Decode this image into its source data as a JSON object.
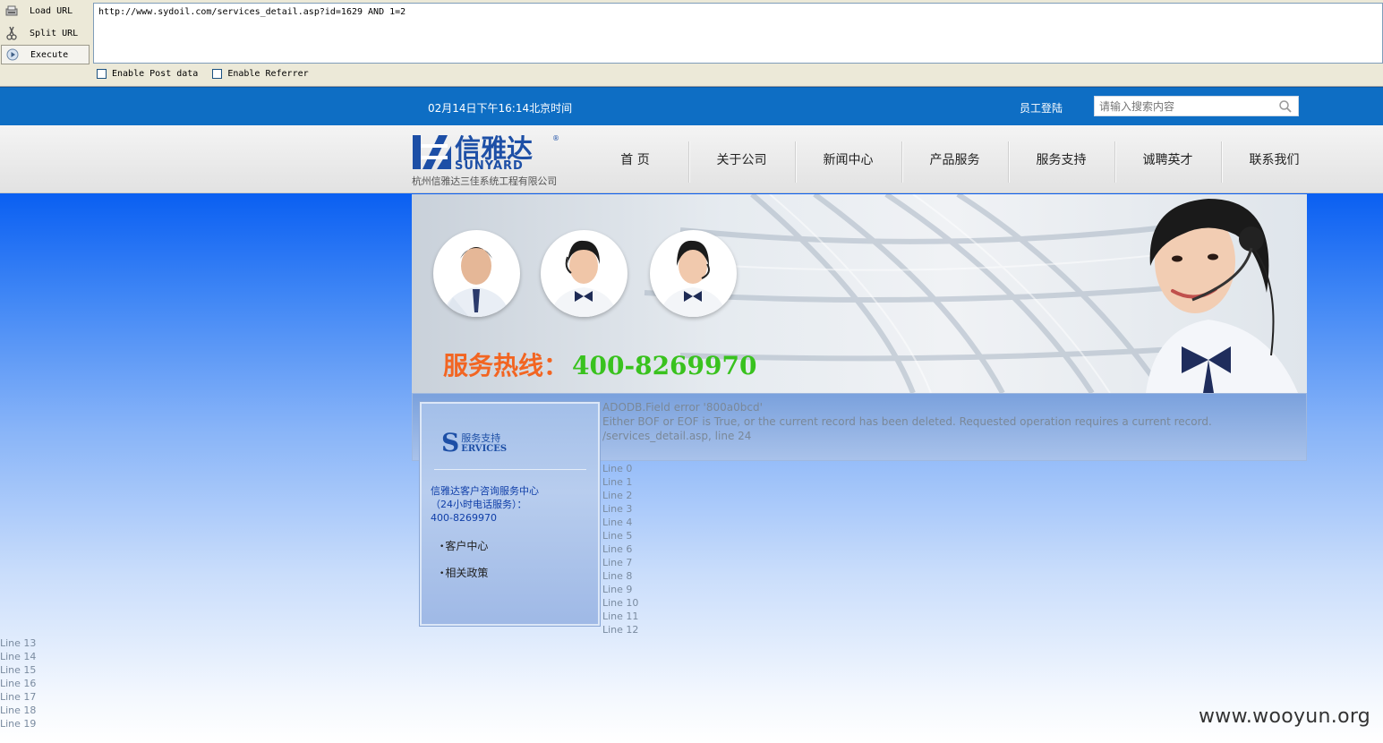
{
  "hackbar": {
    "buttons": [
      "Load URL",
      "Split URL",
      "Execute"
    ],
    "url": "http://www.sydoil.com/services_detail.asp?id=1629 AND 1=2",
    "options": [
      "Enable Post data",
      "Enable Referrer"
    ]
  },
  "topbar": {
    "datetime": "02月14日下午16:14北京时间",
    "login": "员工登陆",
    "search_placeholder": "请输入搜索内容"
  },
  "logo": {
    "brand_cn": "信雅达",
    "brand_en": "SUNYARD",
    "company": "杭州信雅达三佳系统工程有限公司"
  },
  "nav": [
    "首 页",
    "关于公司",
    "新闻中心",
    "产品服务",
    "服务支持",
    "诚聘英才",
    "联系我们"
  ],
  "banner": {
    "hotline_label": "服务热线：",
    "hotline_number": "400-8269970"
  },
  "sidebar": {
    "logo_letter": "S",
    "logo_cn": "服务支持",
    "logo_en": "ERVICES",
    "info_line1": "信雅达客户咨询服务中心",
    "info_line2": "（24小时电话服务）：",
    "info_line3": "400-8269970",
    "links": [
      "客户中心",
      "相关政策"
    ]
  },
  "error": {
    "line1": "ADODB.Field error '800a0bcd'",
    "line2": "Either BOF or EOF is True, or the current record has been deleted. Requested operation requires a current record.",
    "line3": "/services_detail.asp, line 24"
  },
  "lines_a": [
    "Line 0",
    "Line 1",
    "Line 2",
    "Line 3",
    "Line 4",
    "Line 5",
    "Line 6",
    "Line 7",
    "Line 8",
    "Line 9",
    "Line 10",
    "Line 11",
    "Line 12"
  ],
  "lines_b": [
    "Line 13",
    "Line 14",
    "Line 15",
    "Line 16",
    "Line 17",
    "Line 18",
    "Line 19"
  ],
  "watermark": "www.wooyun.org",
  "colors": {
    "topbar": "#0e6ec4",
    "page_bg_top": "#0a5ff2",
    "hotline_label": "#f26522",
    "hotline_number": "#39c21e"
  }
}
